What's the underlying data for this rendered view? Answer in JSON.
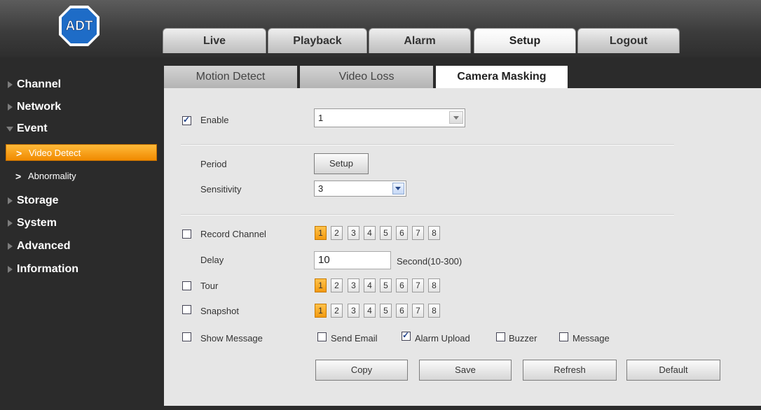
{
  "brand": {
    "logo_text": "ADT",
    "accent": "#f5a623",
    "logo_blue": "#1e6cc7"
  },
  "nav_tabs": [
    "Live",
    "Playback",
    "Alarm",
    "Setup",
    "Logout"
  ],
  "active_nav_tab": "Setup",
  "sidebar": {
    "items": [
      "Channel",
      "Network",
      "Event",
      "Storage",
      "System",
      "Advanced",
      "Information"
    ],
    "event_sub": [
      "Video Detect",
      "Abnormality"
    ],
    "active_sub": "Video Detect"
  },
  "content_tabs": [
    "Motion Detect",
    "Video Loss",
    "Camera Masking"
  ],
  "active_content_tab": "Camera Masking",
  "form": {
    "enable_label": "Enable",
    "enable_checked": true,
    "channel_value": "1",
    "period_label": "Period",
    "setup_button": "Setup",
    "sensitivity_label": "Sensitivity",
    "sensitivity_value": "3",
    "record_channel_label": "Record Channel",
    "delay_label": "Delay",
    "delay_value": "10",
    "delay_unit": "Second(10-300)",
    "tour_label": "Tour",
    "snapshot_label": "Snapshot",
    "show_message_label": "Show Message",
    "channels": [
      "1",
      "2",
      "3",
      "4",
      "5",
      "6",
      "7",
      "8"
    ],
    "selected_channel": "1",
    "send_email_label": "Send Email",
    "alarm_upload_label": "Alarm Upload",
    "alarm_upload_checked": true,
    "buzzer_label": "Buzzer",
    "message_label": "Message"
  },
  "buttons": {
    "copy": "Copy",
    "save": "Save",
    "refresh": "Refresh",
    "default": "Default"
  }
}
